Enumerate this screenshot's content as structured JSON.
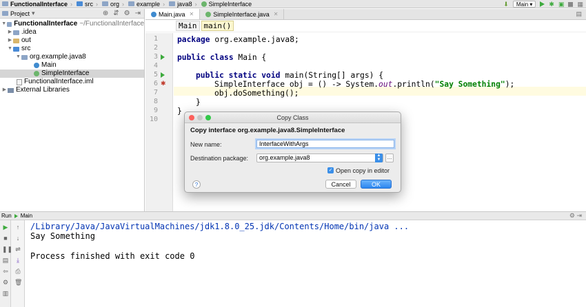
{
  "nav": {
    "crumbs": [
      "FunctionalInterface",
      "src",
      "org",
      "example",
      "java8",
      "SimpleInterface"
    ],
    "run_config": "Main"
  },
  "project": {
    "title": "Project",
    "tree": [
      {
        "label": "FunctionalInterface",
        "extra": "~/FunctionalInterface"
      },
      {
        "label": ".idea"
      },
      {
        "label": "out"
      },
      {
        "label": "src"
      },
      {
        "label": "org.example.java8"
      },
      {
        "label": "Main"
      },
      {
        "label": "SimpleInterface"
      },
      {
        "label": "FunctionalInterface.iml"
      },
      {
        "label": "External Libraries"
      }
    ]
  },
  "editor": {
    "tabs": [
      {
        "label": "Main.java"
      },
      {
        "label": "SimpleInterface.java"
      }
    ],
    "breadcrumbs": [
      "Main",
      "main()"
    ],
    "line_numbers": [
      "1",
      "2",
      "3",
      "4",
      "5",
      "6",
      "7",
      "8",
      "9",
      "10"
    ],
    "code": {
      "l1a": "package",
      "l1b": " org.example.java8;",
      "l3a": "public class",
      "l3b": " Main {",
      "l5a": "public static void",
      "l5b": " main(String[] args) {",
      "l6a": "SimpleInterface obj = () -> System.",
      "l6b": "out",
      "l6c": ".println(",
      "l6d": "\"Say Something\"",
      "l6e": ");",
      "l7": "obj.doSomething();",
      "l8": "}",
      "l9": "}"
    }
  },
  "run": {
    "tab_label": "Run",
    "config": "Main",
    "console": [
      "/Library/Java/JavaVirtualMachines/jdk1.8.0_25.jdk/Contents/Home/bin/java ...",
      "Say Something",
      "Process finished with exit code 0"
    ]
  },
  "dialog": {
    "title": "Copy Class",
    "heading": "Copy interface org.example.java8.SimpleInterface",
    "new_name_label": "New name:",
    "new_name_value": "InterfaceWithArgs",
    "dest_label": "Destination package:",
    "dest_value": "org.example.java8",
    "dots_label": "...",
    "open_copy_label": "Open copy in editor",
    "help_label": "?",
    "cancel_label": "Cancel",
    "ok_label": "OK"
  }
}
